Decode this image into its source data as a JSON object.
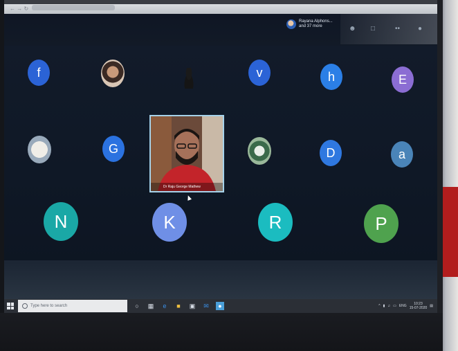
{
  "header": {
    "participants_line1": "Rayana Alphons...",
    "participants_line2": "and 37 more"
  },
  "tiles": [
    {
      "letter": "f",
      "color": "#2b63d6"
    },
    {
      "letter": "v",
      "color": "#2b63d6"
    },
    {
      "letter": "h",
      "color": "#2b7fe6"
    },
    {
      "letter": "E",
      "color": "#8b6dd3"
    },
    {
      "letter": "G",
      "color": "#2b72e0"
    },
    {
      "letter": "D",
      "color": "#2f78e0"
    },
    {
      "letter": "a",
      "color": "#4a84b8"
    },
    {
      "letter": "N",
      "color": "#1aa8a6"
    },
    {
      "letter": "K",
      "color": "#6f8fe6"
    },
    {
      "letter": "R",
      "color": "#1bbcc0"
    },
    {
      "letter": "P",
      "color": "#4fa24e"
    }
  ],
  "video": {
    "name": "Dr Raju George Mathew"
  },
  "taskbar": {
    "search_placeholder": "Type here to search",
    "time": "10:23",
    "date": "15-07-2020"
  }
}
